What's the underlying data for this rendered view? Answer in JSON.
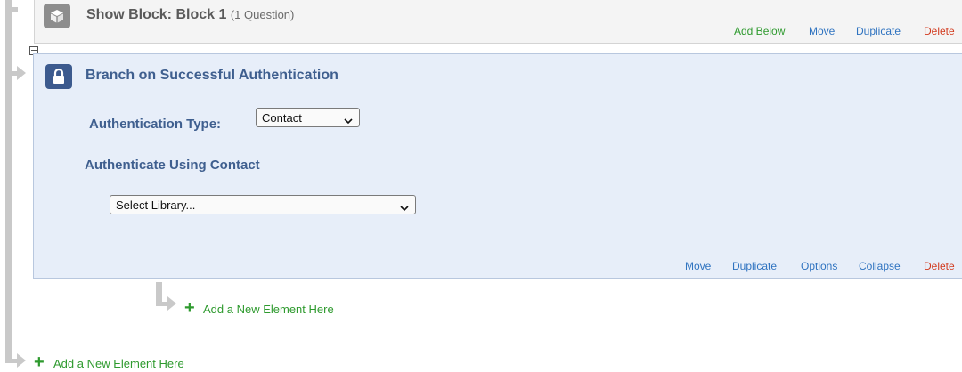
{
  "show_block": {
    "title": "Show Block: Block 1",
    "subtitle": "(1 Question)",
    "actions": {
      "add_below": "Add Below",
      "move": "Move",
      "duplicate": "Duplicate",
      "delete": "Delete"
    }
  },
  "branch_block": {
    "title": "Branch on Successful Authentication",
    "auth_type_label": "Authentication Type:",
    "auth_type_value": "Contact",
    "auth_using_label": "Authenticate Using Contact",
    "library_value": "Select Library...",
    "actions": {
      "move": "Move",
      "duplicate": "Duplicate",
      "options": "Options",
      "collapse": "Collapse",
      "delete": "Delete"
    }
  },
  "add_element_inner": "Add a New Element Here",
  "add_element_outer": "Add a New Element Here",
  "icons": {
    "cube": "cube-icon",
    "lock": "lock-icon",
    "plus": "plus-icon",
    "chevron": "chevron-down-icon",
    "collapse_toggle": "minus-square-icon"
  },
  "colors": {
    "add_green": "#2e9a2e",
    "link_blue": "#2f73c0",
    "delete_red": "#d23b1f",
    "branch_bg": "#e7eef9",
    "branch_title": "#3f5f8f"
  }
}
